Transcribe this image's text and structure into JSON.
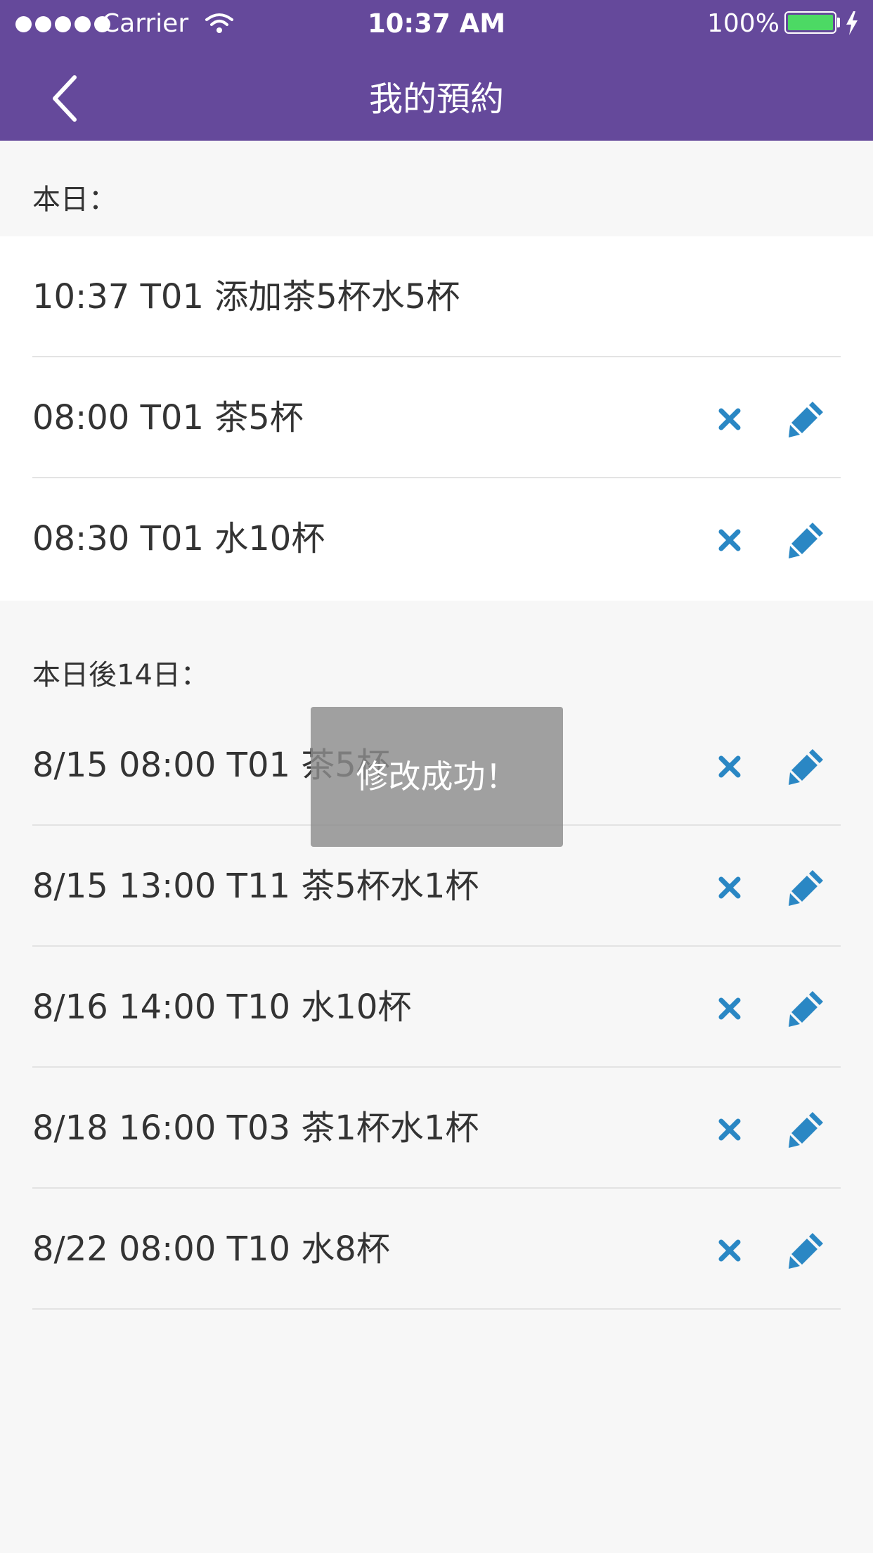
{
  "status_bar": {
    "carrier": "Carrier",
    "time": "10:37 AM",
    "battery": "100%"
  },
  "nav": {
    "title": "我的預約",
    "back_icon": "chevron-left-icon"
  },
  "colors": {
    "header": "#65499b",
    "action": "#2a87c4",
    "battery": "#4cd964"
  },
  "today": {
    "label": "本日：",
    "items": [
      {
        "text": "10:37 T01 添加茶5杯水5杯"
      },
      {
        "text": "08:00 T01 茶5杯"
      },
      {
        "text": "08:30 T01 水10杯"
      }
    ]
  },
  "upcoming": {
    "label": "本日後14日：",
    "items": [
      {
        "text": "8/15 08:00 T01 茶5杯"
      },
      {
        "text": "8/15 13:00 T11 茶5杯水1杯"
      },
      {
        "text": "8/16 14:00 T10 水10杯"
      },
      {
        "text": "8/18 16:00 T03 茶1杯水1杯"
      },
      {
        "text": "8/22 08:00 T10 水8杯"
      }
    ]
  },
  "toast": {
    "message": "修改成功！"
  }
}
